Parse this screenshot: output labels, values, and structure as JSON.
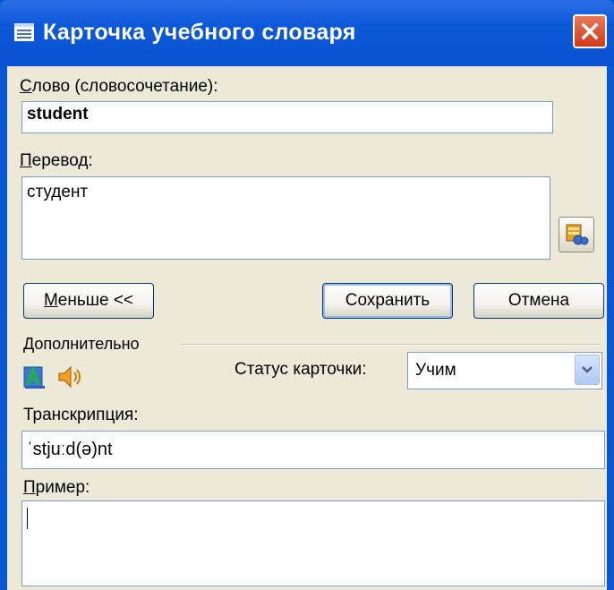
{
  "window": {
    "title": "Карточка учебного словаря",
    "close_icon": "close-icon"
  },
  "word": {
    "label_first": "С",
    "label_rest": "лово (словосочетание):",
    "value": "student"
  },
  "translation": {
    "label_first": "П",
    "label_rest": "еревод:",
    "value": "студент",
    "dictionary_icon": "dictionary-lookup-icon"
  },
  "buttons": {
    "less_first": "М",
    "less_rest": "еньше <<",
    "save": "Сохранить",
    "cancel": "Отмена"
  },
  "additional": {
    "header": "Дополнительно",
    "font_icon": "font-a-icon",
    "sound_icon": "speaker-icon",
    "status_label": "Статус карточки:",
    "status_value": "Учим"
  },
  "transcription": {
    "label": "Транскрипция:",
    "value": "ˈstjuːd(ə)nt"
  },
  "example": {
    "label_first": "П",
    "label_rest": "ример:",
    "value": ""
  },
  "colors": {
    "titlebar": "#0a58d8",
    "dialog_bg": "#ece9d8",
    "close_button": "#d9532f"
  }
}
